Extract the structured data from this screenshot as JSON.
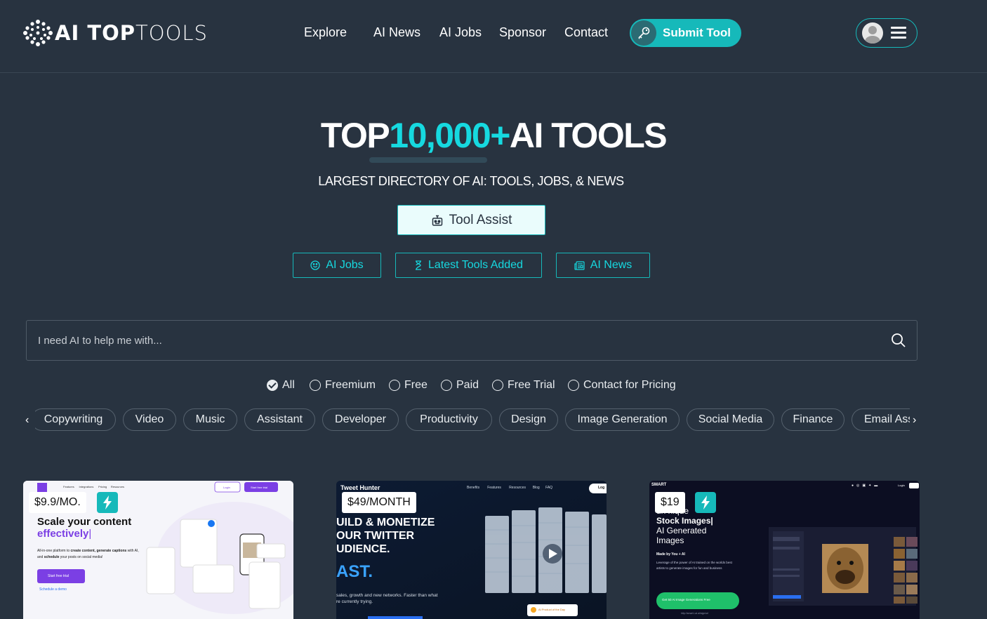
{
  "brand": {
    "logo_bold": "AI TOP",
    "logo_light": "TOOLS"
  },
  "nav": [
    {
      "label": "Explore"
    },
    {
      "label": "AI News"
    },
    {
      "label": "AI Jobs"
    },
    {
      "label": "Sponsor"
    },
    {
      "label": "Contact"
    }
  ],
  "header": {
    "submit_label": "Submit Tool"
  },
  "hero": {
    "title_pre": "TOP",
    "title_accent": "10,000+",
    "title_post": "AI TOOLS",
    "subtitle": "LARGEST DIRECTORY OF AI: TOOLS, JOBS, & NEWS",
    "tool_assist_label": "Tool Assist",
    "quick_links": [
      {
        "label": "AI Jobs",
        "icon": "smile-icon"
      },
      {
        "label": "Latest Tools Added",
        "icon": "hourglass-icon"
      },
      {
        "label": "AI News",
        "icon": "newspaper-icon"
      }
    ]
  },
  "search": {
    "placeholder": "I need AI to help me with...",
    "value": ""
  },
  "filters": [
    {
      "label": "All",
      "checked": true
    },
    {
      "label": "Freemium",
      "checked": false
    },
    {
      "label": "Free",
      "checked": false
    },
    {
      "label": "Paid",
      "checked": false
    },
    {
      "label": "Free Trial",
      "checked": false
    },
    {
      "label": "Contact for Pricing",
      "checked": false
    }
  ],
  "categories": [
    "Copywriting",
    "Video",
    "Music",
    "Assistant",
    "Developer",
    "Productivity",
    "Design",
    "Image Generation",
    "Social Media",
    "Finance",
    "Email Assistant"
  ],
  "cards": [
    {
      "price": "$9.9/MO.",
      "nav_items": [
        "Features",
        "Integrations",
        "Pricing",
        "Resources"
      ],
      "login": "Login",
      "cta": "Start free trial",
      "headline": "Scale your content",
      "headline_accent": "effectively",
      "body_pre": "All-in-one platform to ",
      "body_bold_1": "create content, generate captions",
      "body_mid": " with AI, and ",
      "body_bold_2": "schedule",
      "body_post": " your posts on social media!",
      "button": "Start free trial",
      "link": "Schedule a demo"
    },
    {
      "price": "$49/MONTH",
      "brand": "Tweet Hunter",
      "nav_items": [
        "Benefits",
        "Features",
        "Resources",
        "Blog",
        "FAQ"
      ],
      "login": "Log",
      "lines": [
        "UILD & MONETIZE",
        "OUR TWITTER",
        "UDIENCE."
      ],
      "accent": "AST.",
      "body": "sales, growth and new networks. Faster than what",
      "body2": "re currently trying.",
      "badge": "AI Product of the Day"
    },
    {
      "price": "$19",
      "brand": "SMART",
      "login": "Login",
      "line_cut": "un nique",
      "title": "Stock Images|",
      "line2": "AI Generated",
      "line3": "Images",
      "madeby": "Made by You + AI",
      "body": "Leverage of the power of AI trained on the worlds best artists to generate images for fun and business",
      "button": "Get 50 AI Image Generations Free",
      "footnote": "http://smart.i-ai.ai/sign/url"
    }
  ]
}
